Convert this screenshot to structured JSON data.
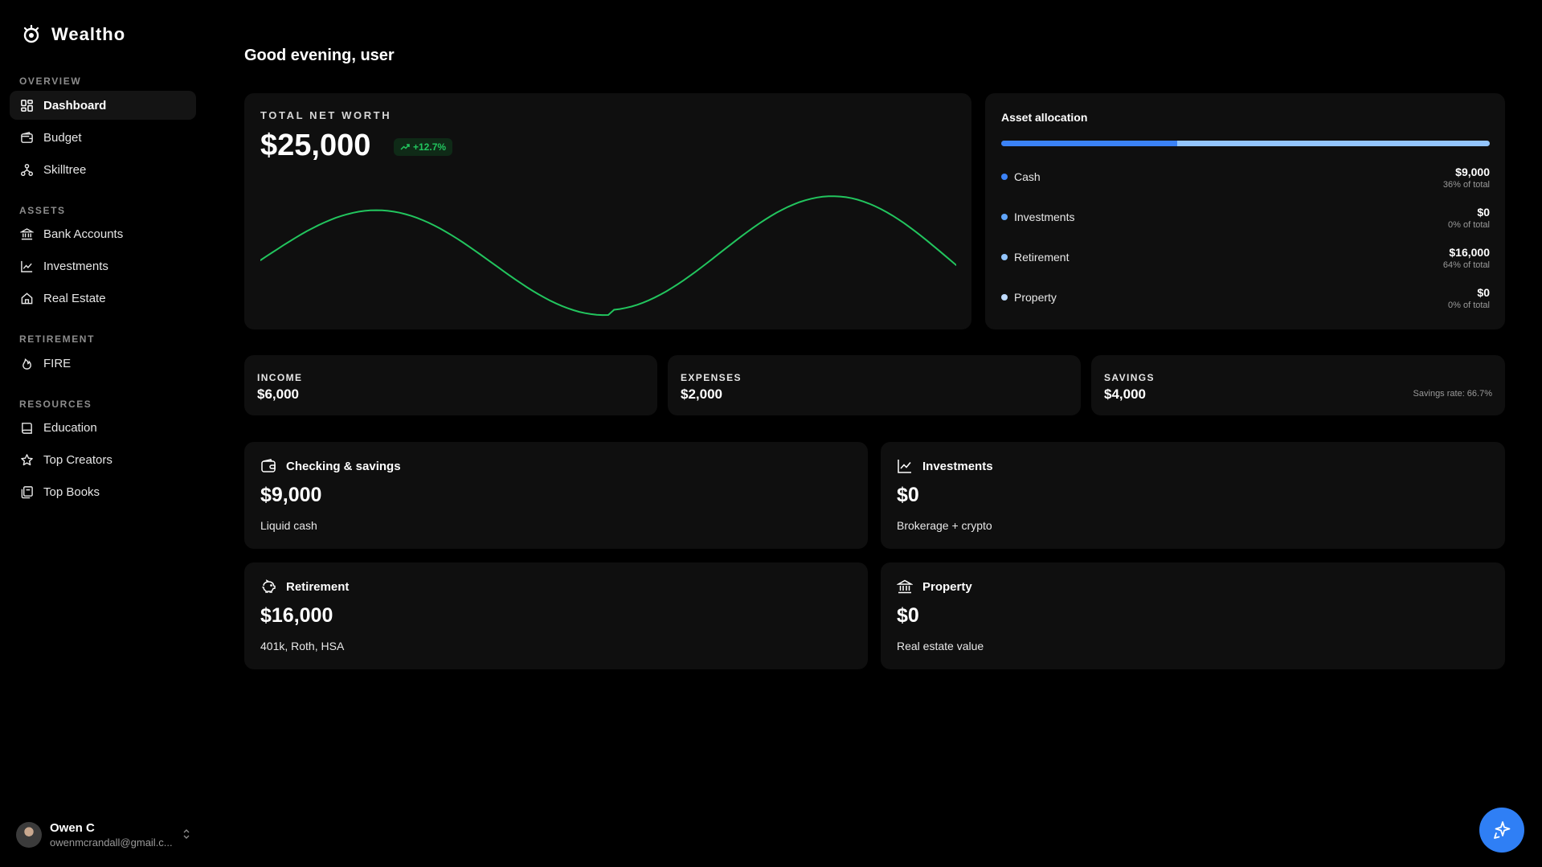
{
  "brand": {
    "name": "Wealtho"
  },
  "sidebar": {
    "sections": [
      {
        "label": "OVERVIEW"
      },
      {
        "label": "ASSETS"
      },
      {
        "label": "RETIREMENT"
      },
      {
        "label": "RESOURCES"
      }
    ],
    "items": [
      {
        "label": "Dashboard",
        "icon": "dashboard-grid-icon"
      },
      {
        "label": "Budget",
        "icon": "wallet-icon"
      },
      {
        "label": "Skilltree",
        "icon": "skilltree-icon"
      },
      {
        "label": "Bank Accounts",
        "icon": "bank-icon"
      },
      {
        "label": "Investments",
        "icon": "line-chart-icon"
      },
      {
        "label": "Real Estate",
        "icon": "home-icon"
      },
      {
        "label": "FIRE",
        "icon": "flame-icon"
      },
      {
        "label": "Education",
        "icon": "book-icon"
      },
      {
        "label": "Top Creators",
        "icon": "star-icon"
      },
      {
        "label": "Top Books",
        "icon": "books-icon"
      }
    ]
  },
  "user": {
    "name": "Owen C",
    "email": "owenmcrandall@gmail.c..."
  },
  "greeting": "Good evening, user",
  "net_worth": {
    "label": "TOTAL NET WORTH",
    "value": "$25,000",
    "change": "+12.7%",
    "color": "#22c55e"
  },
  "allocation": {
    "title": "Asset allocation",
    "items": [
      {
        "name": "Cash",
        "amount": "$9,000",
        "pct_text": "36% of total",
        "fraction": 0.36,
        "color": "#3b82f6"
      },
      {
        "name": "Investments",
        "amount": "$0",
        "pct_text": "0% of total",
        "fraction": 0,
        "color": "#60a5fa"
      },
      {
        "name": "Retirement",
        "amount": "$16,000",
        "pct_text": "64% of total",
        "fraction": 0.64,
        "color": "#93c5fd"
      },
      {
        "name": "Property",
        "amount": "$0",
        "pct_text": "0% of total",
        "fraction": 0,
        "color": "#bfdbfe"
      }
    ]
  },
  "stats": [
    {
      "label": "INCOME",
      "value": "$6,000"
    },
    {
      "label": "EXPENSES",
      "value": "$2,000"
    },
    {
      "label": "SAVINGS",
      "value": "$4,000",
      "note": "Savings rate: 66.7%"
    }
  ],
  "accounts": [
    {
      "title": "Checking & savings",
      "value": "$9,000",
      "desc": "Liquid cash",
      "icon": "wallet-icon"
    },
    {
      "title": "Investments",
      "value": "$0",
      "desc": "Brokerage + crypto",
      "icon": "line-chart-icon"
    },
    {
      "title": "Retirement",
      "value": "$16,000",
      "desc": "401k, Roth, HSA",
      "icon": "piggy-bank-icon"
    },
    {
      "title": "Property",
      "value": "$0",
      "desc": "Real estate value",
      "icon": "bank-icon"
    }
  ],
  "assistant_button": {
    "icon": "sparkle-icon",
    "color": "#2f7ff5"
  }
}
